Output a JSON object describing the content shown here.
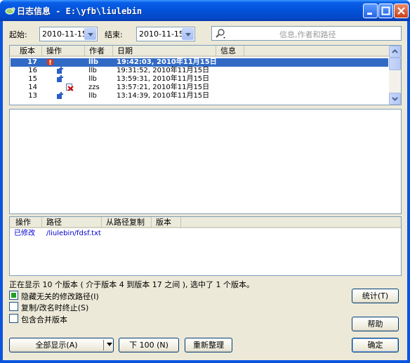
{
  "window": {
    "title": "日志信息 - E:\\yfb\\liulebin"
  },
  "filter": {
    "from_label": "起始:",
    "from_date": "2010-11-15",
    "to_label": "结束:",
    "to_date": "2010-11-15",
    "search_placeholder": "信息,作者和路径"
  },
  "revisions": {
    "columns": [
      "版本",
      "操作",
      "作者",
      "日期",
      "信息"
    ],
    "rows": [
      {
        "rev": "17",
        "author": "llb",
        "date": "19:42:03, 2010年11月15日",
        "action_icon": "modified-icon",
        "selected": true
      },
      {
        "rev": "16",
        "author": "llb",
        "date": "19:31:52, 2010年11月15日",
        "action_icon": "added-icon"
      },
      {
        "rev": "15",
        "author": "llb",
        "date": "13:59:31, 2010年11月15日",
        "action_icon": "added-icon"
      },
      {
        "rev": "14",
        "author": "zzs",
        "date": "13:57:21, 2010年11月15日",
        "action_icon": "deleted-icon"
      },
      {
        "rev": "13",
        "author": "llb",
        "date": "13:14:39, 2010年11月15日",
        "action_icon": "added-icon"
      }
    ]
  },
  "paths": {
    "columns": [
      "操作",
      "路径",
      "从路径复制",
      "版本"
    ],
    "rows": [
      {
        "action": "已修改",
        "path": "/liulebin/fdsf.txt"
      }
    ]
  },
  "status_text": "正在显示 10 个版本 ( 介于版本 4 到版本 17 之间 ), 选中了 1 个版本。",
  "options": {
    "hide_unrelated": "隐藏无关的修改路径(I)",
    "stop_on_copy": "复制/改名时终止(S)",
    "include_merged": "包含合并版本"
  },
  "buttons": {
    "show_all": "全部显示(A)",
    "next_100": "下 100 (N)",
    "refresh": "重新整理",
    "stats": "统计(T)",
    "help": "帮助",
    "ok": "确定"
  },
  "colors": {
    "selection": "#316ac5",
    "path_text": "#0000cc"
  }
}
